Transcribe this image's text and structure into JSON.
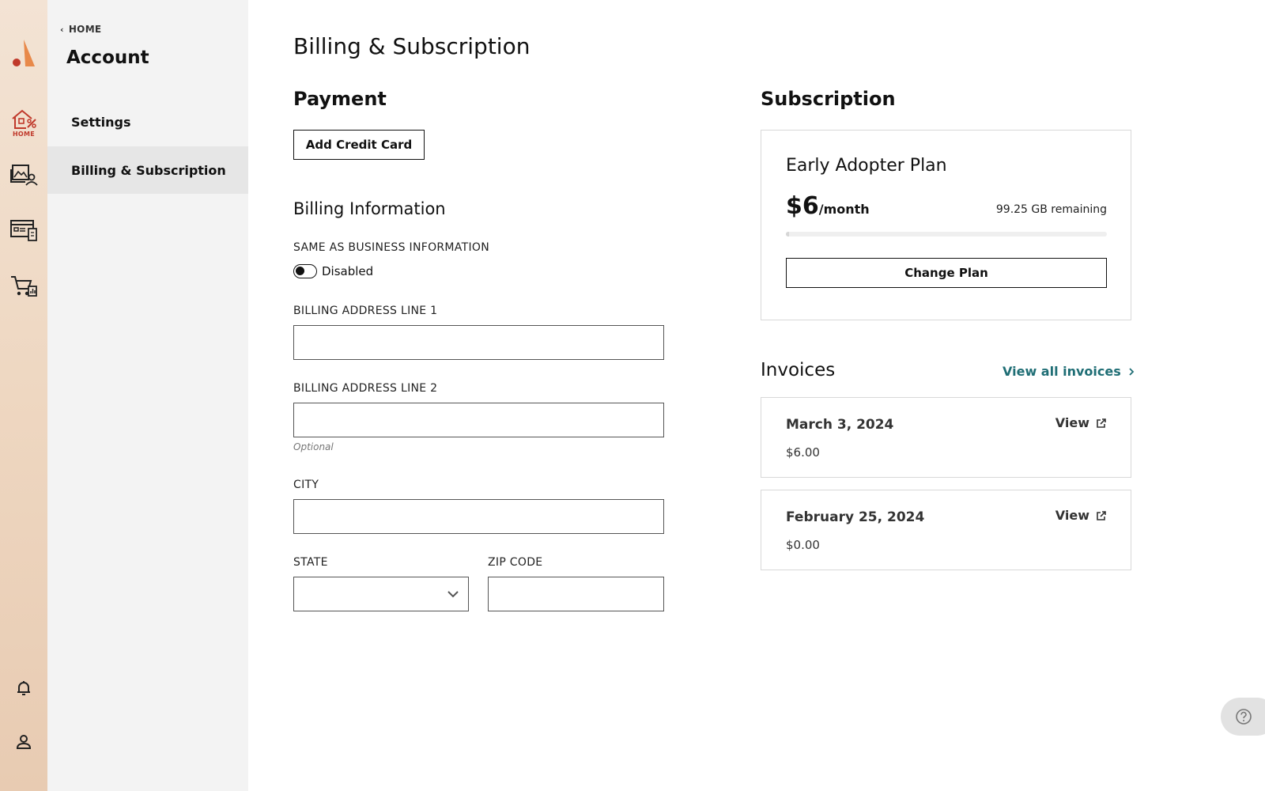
{
  "rail": {
    "home_label": "HOME"
  },
  "sidebar": {
    "back_label": "HOME",
    "title": "Account",
    "items": [
      {
        "label": "Settings"
      },
      {
        "label": "Billing & Subscription"
      }
    ]
  },
  "page": {
    "title": "Billing & Subscription"
  },
  "payment": {
    "heading": "Payment",
    "add_card_label": "Add Credit Card"
  },
  "billing": {
    "heading": "Billing Information",
    "same_as_label": "SAME AS BUSINESS INFORMATION",
    "toggle_state": "Disabled",
    "address1_label": "BILLING ADDRESS LINE 1",
    "address1_value": "",
    "address2_label": "BILLING ADDRESS LINE 2",
    "address2_value": "",
    "address2_hint": "Optional",
    "city_label": "CITY",
    "city_value": "",
    "state_label": "STATE",
    "state_value": "",
    "zip_label": "ZIP CODE",
    "zip_value": ""
  },
  "subscription": {
    "heading": "Subscription",
    "plan_name": "Early Adopter Plan",
    "price": "$6",
    "period": "/month",
    "remaining": "99.25 GB remaining",
    "usage_fraction": 0.01,
    "change_plan_label": "Change Plan"
  },
  "invoices": {
    "heading": "Invoices",
    "view_all_label": "View all invoices",
    "items": [
      {
        "date": "March 3, 2024",
        "amount": "$6.00",
        "view_label": "View"
      },
      {
        "date": "February 25, 2024",
        "amount": "$0.00",
        "view_label": "View"
      }
    ]
  },
  "colors": {
    "accent_link": "#1f6e75",
    "home_accent": "#c0392b"
  }
}
